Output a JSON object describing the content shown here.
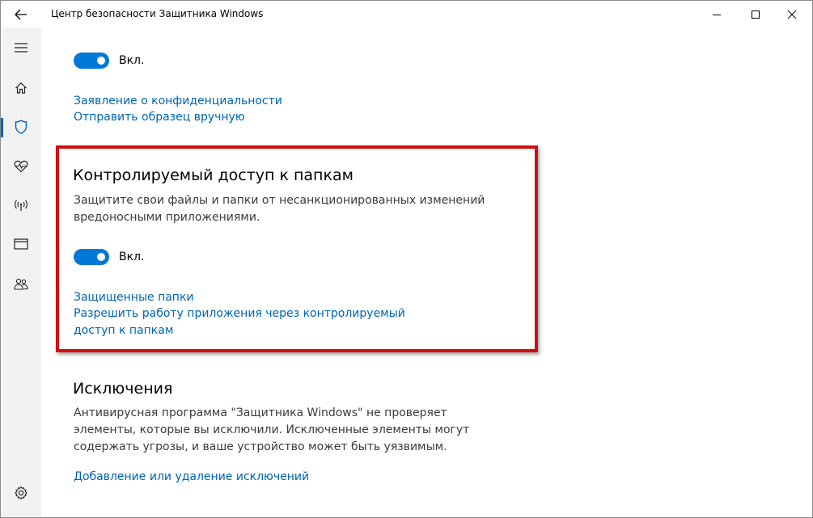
{
  "window": {
    "title": "Центр безопасности Защитника Windows"
  },
  "sidebar": {
    "items": [
      {
        "name": "menu",
        "icon": "hamburger-icon"
      },
      {
        "name": "home",
        "icon": "home-icon"
      },
      {
        "name": "virus-protection",
        "icon": "shield-icon",
        "active": true
      },
      {
        "name": "device-health",
        "icon": "heart-pulse-icon"
      },
      {
        "name": "firewall",
        "icon": "antenna-icon"
      },
      {
        "name": "app-browser",
        "icon": "browser-window-icon"
      },
      {
        "name": "family",
        "icon": "family-icon"
      },
      {
        "name": "settings",
        "icon": "gear-icon"
      }
    ]
  },
  "top_section": {
    "toggle_label": "Вкл.",
    "toggle_on": true,
    "links": [
      "Заявление о конфиденциальности",
      "Отправить образец вручную"
    ]
  },
  "cfa_section": {
    "title": "Контролируемый доступ к папкам",
    "description_lines": [
      "Защитите свои файлы и папки от несанкционированных изменений",
      "вредоносными приложениями."
    ],
    "toggle_label": "Вкл.",
    "toggle_on": true,
    "links": [
      "Защищенные папки",
      "Разрешить работу приложения через контролируемый",
      "доступ к папкам"
    ]
  },
  "exclusions_section": {
    "title": "Исключения",
    "description_lines": [
      "Антивирусная программа \"Защитника Windows\" не проверяет",
      "элементы, которые вы исключили. Исключенные элементы могут",
      "содержать угрозы, и ваше устройство может быть уязвимым."
    ],
    "link": "Добавление или удаление исключений"
  },
  "colors": {
    "accent": "#0078d7",
    "link": "#0063b1",
    "highlight": "#d10d12"
  }
}
